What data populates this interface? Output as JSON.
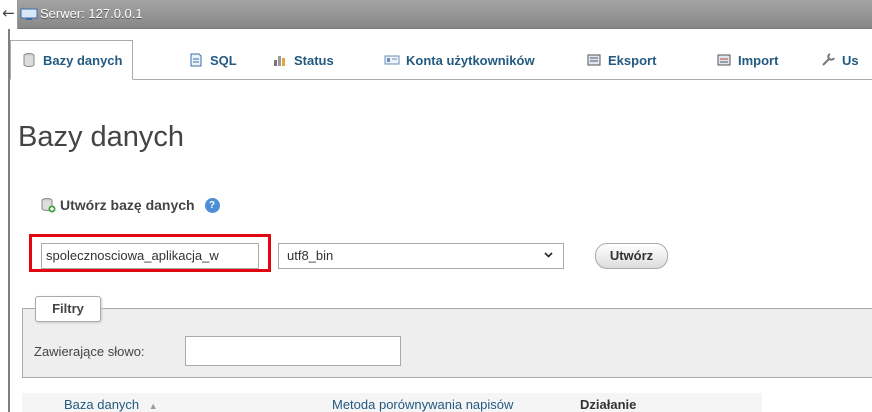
{
  "topbar": {
    "back_icon": "arrow-left-icon",
    "server_label": "Serwer: 127.0.0.1"
  },
  "tabs": [
    {
      "label": "Bazy danych",
      "icon": "database-icon"
    },
    {
      "label": "SQL",
      "icon": "sql-document-icon"
    },
    {
      "label": "Status",
      "icon": "status-chart-icon"
    },
    {
      "label": "Konta użytkowników",
      "icon": "users-icon"
    },
    {
      "label": "Eksport",
      "icon": "export-icon"
    },
    {
      "label": "Import",
      "icon": "import-icon"
    },
    {
      "label": "Us",
      "icon": "wrench-icon"
    }
  ],
  "page": {
    "title": "Bazy danych"
  },
  "create": {
    "heading": "Utwórz bazę danych",
    "db_name_value": "spolecznosciowa_aplikacja_w",
    "collation_value": "utf8_bin",
    "create_button": "Utwórz",
    "help_icon": "help-icon"
  },
  "filters": {
    "legend": "Filtry",
    "label": "Zawierające słowo:",
    "value": ""
  },
  "table": {
    "columns": [
      "Baza danych",
      "Metoda porównywania napisów",
      "Działanie"
    ],
    "sort_indicator": "▲"
  },
  "colors": {
    "highlight": "#e30613",
    "link": "#235a81",
    "topbar": "#9a9a9a"
  }
}
